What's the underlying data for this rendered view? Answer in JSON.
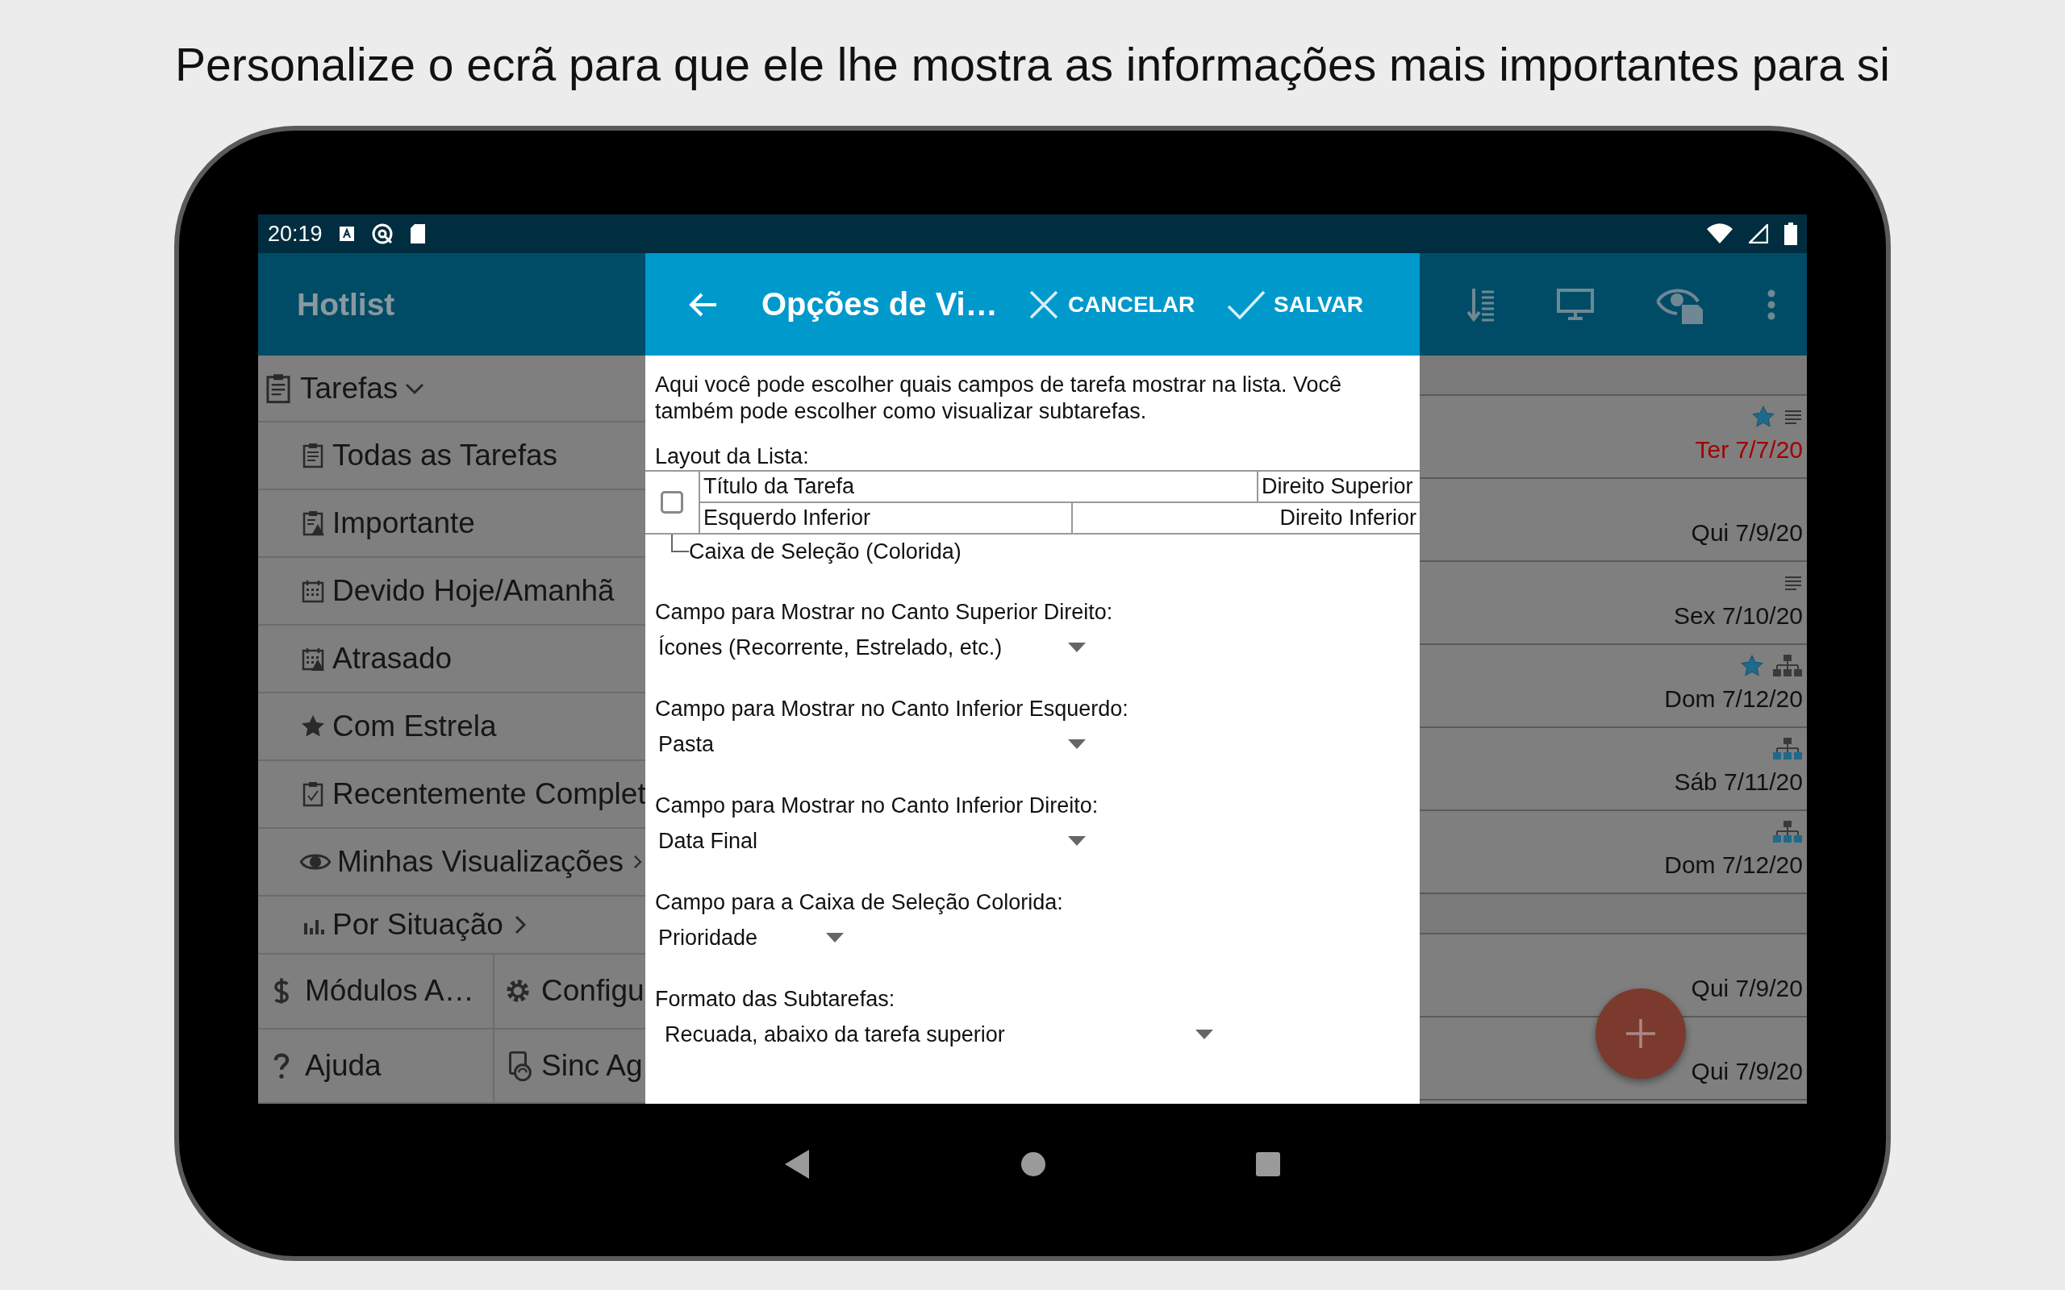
{
  "headline": "Personalize o ecrã para que ele lhe mostra as informações mais importantes para si",
  "status_bar": {
    "time": "20:19"
  },
  "app_bar": {
    "title": "Hotlist"
  },
  "drawer": {
    "header": {
      "label": "Tarefas",
      "expanded": true
    },
    "items": [
      {
        "label": "Todas as Tarefas",
        "submenu": false
      },
      {
        "label": "Importante",
        "submenu": false
      },
      {
        "label": "Devido Hoje/Amanhã",
        "submenu": false
      },
      {
        "label": "Atrasado",
        "submenu": false
      },
      {
        "label": "Com Estrela",
        "submenu": false
      },
      {
        "label": "Recentemente Complet",
        "submenu": false
      },
      {
        "label": "Minhas Visualizações",
        "submenu": true
      },
      {
        "label": "Por Situação",
        "submenu": true
      }
    ],
    "footer": [
      {
        "label": "Módulos A…"
      },
      {
        "label": "Configu"
      },
      {
        "label": "Ajuda"
      },
      {
        "label": "Sinc Ag"
      }
    ]
  },
  "dialog": {
    "title": "Opções de Vi…",
    "cancel": "CANCELAR",
    "save": "SALVAR",
    "description": "Aqui você pode escolher quais campos de tarefa mostrar na lista. Você também pode escolher como visualizar subtarefas.",
    "layout_label": "Layout da Lista:",
    "layout": {
      "top_left": "Título da Tarefa",
      "top_right": "Direito Superior",
      "bottom_left": "Esquerdo Inferior",
      "bottom_right": "Direito Inferior",
      "checkbox_label": "Caixa de Seleção (Colorida)",
      "checked": false
    },
    "fields": [
      {
        "label": "Campo para Mostrar no Canto Superior Direito:",
        "value": "Ícones (Recorrente, Estrelado, etc.)"
      },
      {
        "label": "Campo para Mostrar no Canto Inferior Esquerdo:",
        "value": "Pasta"
      },
      {
        "label": "Campo para Mostrar no Canto Inferior Direito:",
        "value": "Data Final"
      },
      {
        "label": "Campo para a Caixa de Seleção Colorida:",
        "value": "Prioridade"
      },
      {
        "label": "Formato das Subtarefas:",
        "value": "Recuada, abaixo da tarefa superior"
      }
    ]
  },
  "tasks": [
    {
      "kind": "band"
    },
    {
      "kind": "task",
      "date": "Ter 7/7/20",
      "overdue": true,
      "starred": true,
      "notes": true,
      "has_subtasks": false,
      "is_subtask": false
    },
    {
      "kind": "task",
      "date": "Qui 7/9/20",
      "overdue": false,
      "starred": false,
      "notes": false,
      "has_subtasks": false,
      "is_subtask": false
    },
    {
      "kind": "task",
      "date": "Sex 7/10/20",
      "overdue": false,
      "starred": false,
      "notes": true,
      "has_subtasks": false,
      "is_subtask": false
    },
    {
      "kind": "task",
      "date": "Dom 7/12/20",
      "overdue": false,
      "starred": true,
      "notes": false,
      "has_subtasks": true,
      "is_subtask": false
    },
    {
      "kind": "task",
      "date": "Sáb 7/11/20",
      "overdue": false,
      "starred": false,
      "notes": false,
      "has_subtasks": false,
      "is_subtask": true
    },
    {
      "kind": "task",
      "date": "Dom 7/12/20",
      "overdue": false,
      "starred": false,
      "notes": false,
      "has_subtasks": false,
      "is_subtask": true
    },
    {
      "kind": "band"
    },
    {
      "kind": "task",
      "date": "Qui 7/9/20",
      "overdue": false,
      "starred": false,
      "notes": false,
      "has_subtasks": false,
      "is_subtask": false
    },
    {
      "kind": "task",
      "date": "Qui 7/9/20",
      "overdue": false,
      "starred": false,
      "notes": false,
      "has_subtasks": false,
      "is_subtask": false
    }
  ]
}
